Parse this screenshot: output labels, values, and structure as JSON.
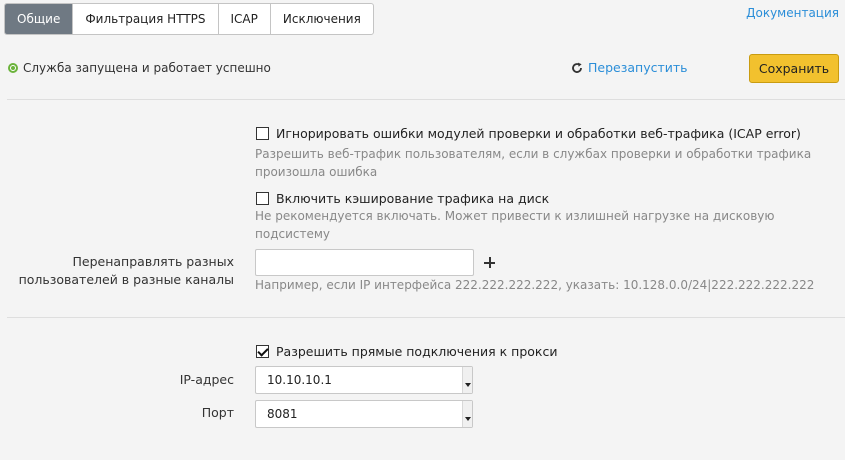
{
  "tabs": [
    {
      "label": "Общие",
      "active": true
    },
    {
      "label": "Фильтрация HTTPS",
      "active": false
    },
    {
      "label": "ICAP",
      "active": false
    },
    {
      "label": "Исключения",
      "active": false
    }
  ],
  "header": {
    "docs_link": "Документация",
    "status_text": "Служба запущена и работает успешно",
    "restart_label": "Перезапустить",
    "save_label": "Сохранить"
  },
  "options": {
    "ignore_icap_errors": {
      "label": "Игнорировать ошибки модулей проверки и обработки веб-трафика (ICAP error)",
      "hint_line1": "Разрешить веб-трафик пользователям, если в службах проверки и обработки трафика",
      "hint_line2": "произошла ошибка",
      "checked": false
    },
    "disk_cache": {
      "label": "Включить кэширование трафика на диск",
      "hint": "Не рекомендуется включать. Может привести к излишней нагрузке на дисковую подсистему",
      "checked": false
    }
  },
  "redirect": {
    "label_line1": "Перенаправлять разных",
    "label_line2": "пользователей в разные каналы",
    "input_value": "",
    "hint": "Например, если IP интерфейса 222.222.222.222, указать: 10.128.0.0/24|222.222.222.222"
  },
  "direct": {
    "label": "Разрешить прямые подключения к прокси",
    "checked": true,
    "ip_label": "IP-адрес",
    "ip_value": "10.10.10.1",
    "port_label": "Порт",
    "port_value": "8081"
  },
  "colors": {
    "accent": "#2b8ed8",
    "save_button": "#f2c12e",
    "active_tab": "#6f7983",
    "status_ok": "#6bb33b"
  }
}
